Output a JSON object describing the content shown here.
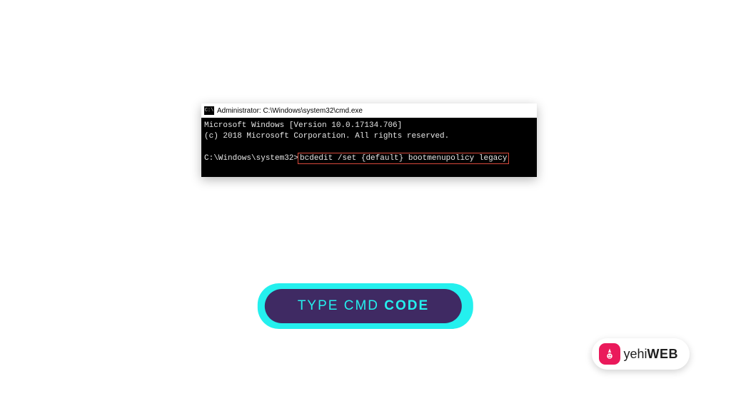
{
  "cmd": {
    "title": "Administrator: C:\\Windows\\system32\\cmd.exe",
    "icon_glyph": "C:\\",
    "line1": "Microsoft Windows [Version 10.0.17134.706]",
    "line2": "(c) 2018 Microsoft Corporation. All rights reserved.",
    "prompt": "C:\\Windows\\system32>",
    "command": "bcdedit /set {default} bootmenupolicy legacy"
  },
  "step": {
    "caption_thin": "TYPE CMD ",
    "caption_bold": "CODE"
  },
  "brand": {
    "thin": "yehi",
    "heavy": "WEB"
  }
}
